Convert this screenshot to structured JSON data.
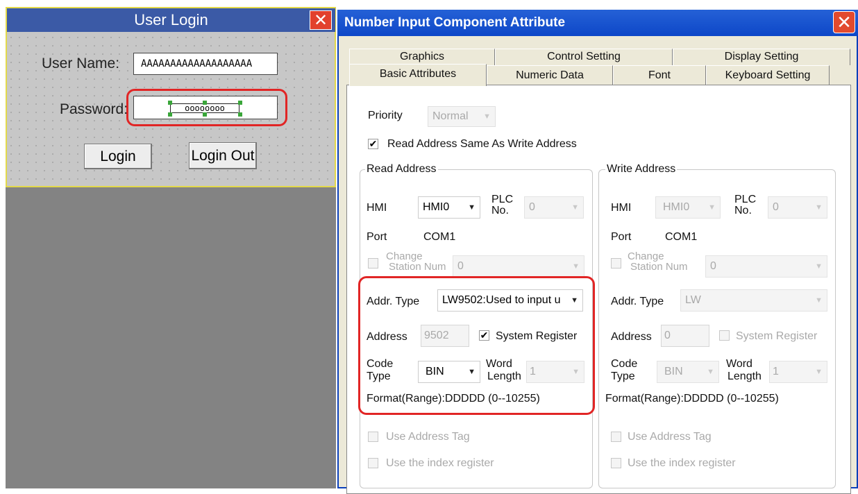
{
  "login": {
    "title": "User Login",
    "user_label": "User Name:",
    "user_value": "AAAAAAAAAAAAAAAAAAA",
    "pass_label": "Password:",
    "pass_value": "oooooooo",
    "login_button": "Login",
    "logout_button": "Login Out"
  },
  "dialog": {
    "title": "Number Input Component Attribute",
    "tabs_back": [
      "Graphics",
      "Control Setting",
      "Display Setting"
    ],
    "tabs_front": [
      "Basic Attributes",
      "Numeric Data",
      "Font",
      "Keyboard Setting"
    ],
    "priority_label": "Priority",
    "priority_value": "Normal",
    "read_same_label": "Read Address Same As Write Address",
    "read": {
      "group_title": "Read Address",
      "hmi_label": "HMI",
      "hmi_value": "HMI0",
      "plc_label_1": "PLC",
      "plc_label_2": "No.",
      "plc_value": "0",
      "port_label": "Port",
      "port_value": "COM1",
      "change_label_1": "Change",
      "change_label_2": "Station Num",
      "change_value": "0",
      "addr_type_label": "Addr. Type",
      "addr_type_value": "LW9502:Used to input u",
      "address_label": "Address",
      "address_value": "9502",
      "system_register_label": "System Register",
      "code_label_1": "Code",
      "code_label_2": "Type",
      "code_value": "BIN",
      "word_label_1": "Word",
      "word_label_2": "Length",
      "word_value": "1",
      "format": "Format(Range):DDDDD (0--10255)",
      "use_tag_label": "Use Address Tag",
      "use_index_label": "Use the index register"
    },
    "write": {
      "group_title": "Write Address",
      "hmi_label": "HMI",
      "hmi_value": "HMI0",
      "plc_label_1": "PLC",
      "plc_label_2": "No.",
      "plc_value": "0",
      "port_label": "Port",
      "port_value": "COM1",
      "change_label_1": "Change",
      "change_label_2": "Station Num",
      "change_value": "0",
      "addr_type_label": "Addr. Type",
      "addr_type_value": "LW",
      "address_label": "Address",
      "address_value": "0",
      "system_register_label": "System Register",
      "code_label_1": "Code",
      "code_label_2": "Type",
      "code_value": "BIN",
      "word_label_1": "Word",
      "word_label_2": "Length",
      "word_value": "1",
      "format": "Format(Range):DDDDD (0--10255)",
      "use_tag_label": "Use Address Tag",
      "use_index_label": "Use the index register"
    }
  }
}
